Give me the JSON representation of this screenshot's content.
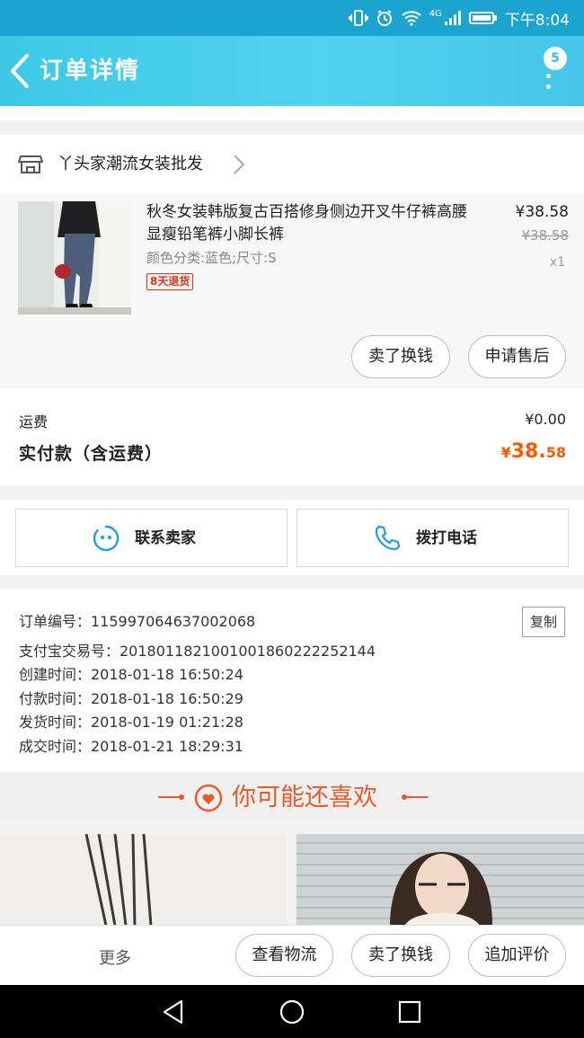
{
  "status": {
    "network": "4G",
    "time": "下午8:04"
  },
  "header": {
    "title": "订单详情",
    "badge": "5"
  },
  "shop": {
    "name": "丫头家潮流女装批发"
  },
  "product": {
    "title": "秋冬女装韩版复古百搭修身侧边开叉牛仔裤高腰显瘦铅笔裤小脚长裤",
    "spec": "颜色分类:蓝色;尺寸:S",
    "tag": "8天退货",
    "price": "¥38.58",
    "original_price": "¥38.58",
    "quantity": "x1"
  },
  "actions": {
    "refund": "卖了换钱",
    "after_sale": "申请售后"
  },
  "totals": {
    "shipping_label": "运费",
    "shipping_value": "¥0.00",
    "paid_label": "实付款（含运费）",
    "paid_symbol": "¥",
    "paid_int": "38.",
    "paid_dec": "58"
  },
  "contact": {
    "seller": "联系卖家",
    "call": "拨打电话"
  },
  "order_info": {
    "copy": "复制",
    "lines": [
      "订单编号：115997064637002068",
      "支付宝交易号：2018011821001001860222252144",
      "创建时间：2018-01-18 16:50:24",
      "付款时间：2018-01-18 16:50:29",
      "发货时间：2018-01-19 01:21:28",
      "成交时间：2018-01-21 18:29:31"
    ]
  },
  "guess": {
    "title": "你可能还喜欢"
  },
  "bottom": {
    "more": "更多",
    "logistics": "查看物流",
    "resell": "卖了换钱",
    "review": "追加评价"
  },
  "colors": {
    "accent": "#4fd3ef",
    "price": "#ff5a00",
    "tag": "#e0321e",
    "guess": "#ea5a2a"
  }
}
